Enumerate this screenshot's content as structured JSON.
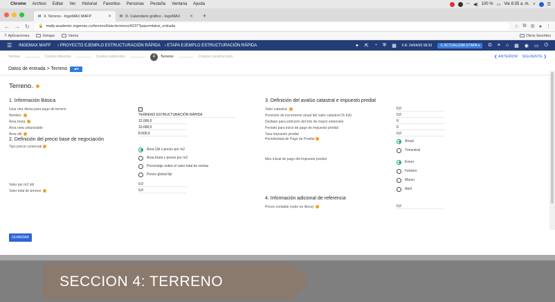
{
  "macos": {
    "app": "Chrome",
    "menu": [
      "Archivo",
      "Editar",
      "Ver",
      "Historial",
      "Favoritos",
      "Personas",
      "Pestaña",
      "Ventana",
      "Ayuda"
    ],
    "battery": "100 %",
    "clock": "Vie 8:35 a. m."
  },
  "browser": {
    "tabs": [
      {
        "favicon": "M",
        "title": "4. Terreno - IngeMAX MAFP"
      },
      {
        "favicon": "M",
        "title": "D. Calendario gráfico - IngeMAX"
      }
    ],
    "url": "mafp-academic.ingemax.co/terreno/lista-terrenos/4237?paso=datos_entrada",
    "bookmarks": [
      "Aplicaciones",
      "Gmaps",
      "Varios"
    ],
    "other_bookmarks": "Otros favoritos"
  },
  "appbar": {
    "brand": "INGEMAX MAFP",
    "crumb1": "› PROYECTO EJEMPLO ESTRUCTURACIÓN RÁPIDA",
    "crumb2": "› ETAPA EJEMPLO ESTRUCTURACIÓN RÁPIDA",
    "fa_date": "F.A: 24/04/20 08:33",
    "update_label": "↻ ACTUALIZAR ETAPA ▾"
  },
  "stepper": {
    "steps": [
      "Ventas",
      "Costos directos",
      "Costos indirectos",
      "Terreno",
      "Costos construcción"
    ],
    "active_number": "4",
    "prev": "❮ ANTERIOR",
    "next": "SIGUIENTE ❯"
  },
  "subhead": {
    "text": "Datos de entrada > Terreno"
  },
  "form": {
    "title": "Terreno.",
    "sec1": "1. Información Básica",
    "use_other_currency": "Usar otra divisa para pago de terreno",
    "name_label": "Nombre",
    "name_value": "TERRENO ESTRUCTURACIÓN RÁPIDA",
    "gross_area_label": "Área bruta",
    "gross_area_value": "12.000,0",
    "net_area_label": "Área neta urbanizable",
    "net_area_value": "10.000,0",
    "useful_area_label": "Área útil",
    "useful_area_value": "8.500,0",
    "sec2": "2. Definición del precio base de negociación",
    "price_type_label": "Tipo precio comercial",
    "price_options": [
      "Área Útil x precio por m2",
      "Área bruta x precio por m2",
      "Porcentaje sobre el valor total de ventas",
      "Precio global fijo"
    ],
    "price_m2_label": "Valor por m2 útil",
    "price_m2_value": "0,0",
    "total_value_label": "Valor total de terreno",
    "total_value_value": "0,0",
    "sec3": "3. Definición del avalúo catastral e impuesto predial",
    "cadastral_label": "Valor catastral",
    "cadastral_value": "0,0",
    "increment_label": "Previsión de incremento anual del valor catastral (% EA)",
    "increment_value": "0,0",
    "shift_label": "Desfase para extinción del lote de mayor extensión",
    "shift_value": "0",
    "start_period_label": "Periodo para inicio de pago de impuesto predial",
    "start_period_value": "0",
    "tax_rate_label": "Tasa impuesto predial",
    "tax_rate_value": "0,0",
    "periodicity_label": "Periodicidad de Pago de Predial",
    "periodicity_options": [
      "Anual",
      "Trimestral"
    ],
    "start_month_label": "Mes inicial de pago del impuesto predial",
    "month_options": [
      "Enero",
      "Febrero",
      "Marzo",
      "Abril"
    ],
    "sec4": "4. Información adicional de referencia",
    "paid_price_label": "Precio contable (valor en libros)",
    "paid_price_value": "0,0",
    "save": "GUARDAR"
  },
  "banner": {
    "text": "SECCION 4: TERRENO"
  }
}
